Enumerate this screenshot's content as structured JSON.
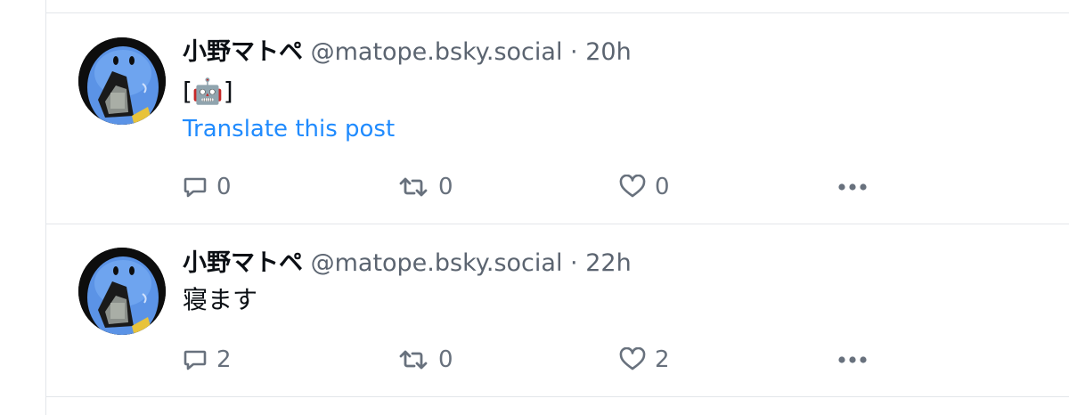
{
  "posts": [
    {
      "display_name": "小野マトペ",
      "handle": "@matope.bsky.social",
      "separator": "·",
      "time": "20h",
      "text": "[🤖]",
      "translate_label": "Translate this post",
      "reply_count": "0",
      "repost_count": "0",
      "like_count": "0"
    },
    {
      "display_name": "小野マトペ",
      "handle": "@matope.bsky.social",
      "separator": "·",
      "time": "22h",
      "text": "寝ます",
      "reply_count": "2",
      "repost_count": "0",
      "like_count": "2"
    }
  ],
  "icons": {
    "reply": "speech-bubble",
    "repost": "repost-arrows",
    "like": "heart-outline",
    "more": "ellipsis-horizontal"
  },
  "colors": {
    "link": "#208bfe",
    "muted": "#68717d",
    "divider": "#e3e6ea"
  }
}
